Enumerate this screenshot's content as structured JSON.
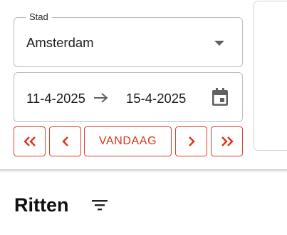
{
  "filters": {
    "city": {
      "label": "Stad",
      "value": "Amsterdam",
      "icon": "dropdown-caret-icon"
    },
    "date_range": {
      "start": "11-4-2025",
      "end": "15-4-2025",
      "separator_icon": "arrow-right-icon",
      "icon": "calendar-icon"
    }
  },
  "navigation": {
    "first_icon": "double-chevron-left-icon",
    "prev_icon": "chevron-left-icon",
    "today_label": "VANDAAG",
    "next_icon": "chevron-right-icon",
    "last_icon": "double-chevron-right-icon"
  },
  "section": {
    "title": "Ritten",
    "filter_icon": "filter-icon"
  },
  "colors": {
    "accent": "#d8341c",
    "border": "#bdbdbd",
    "icon_gray": "#616161"
  }
}
